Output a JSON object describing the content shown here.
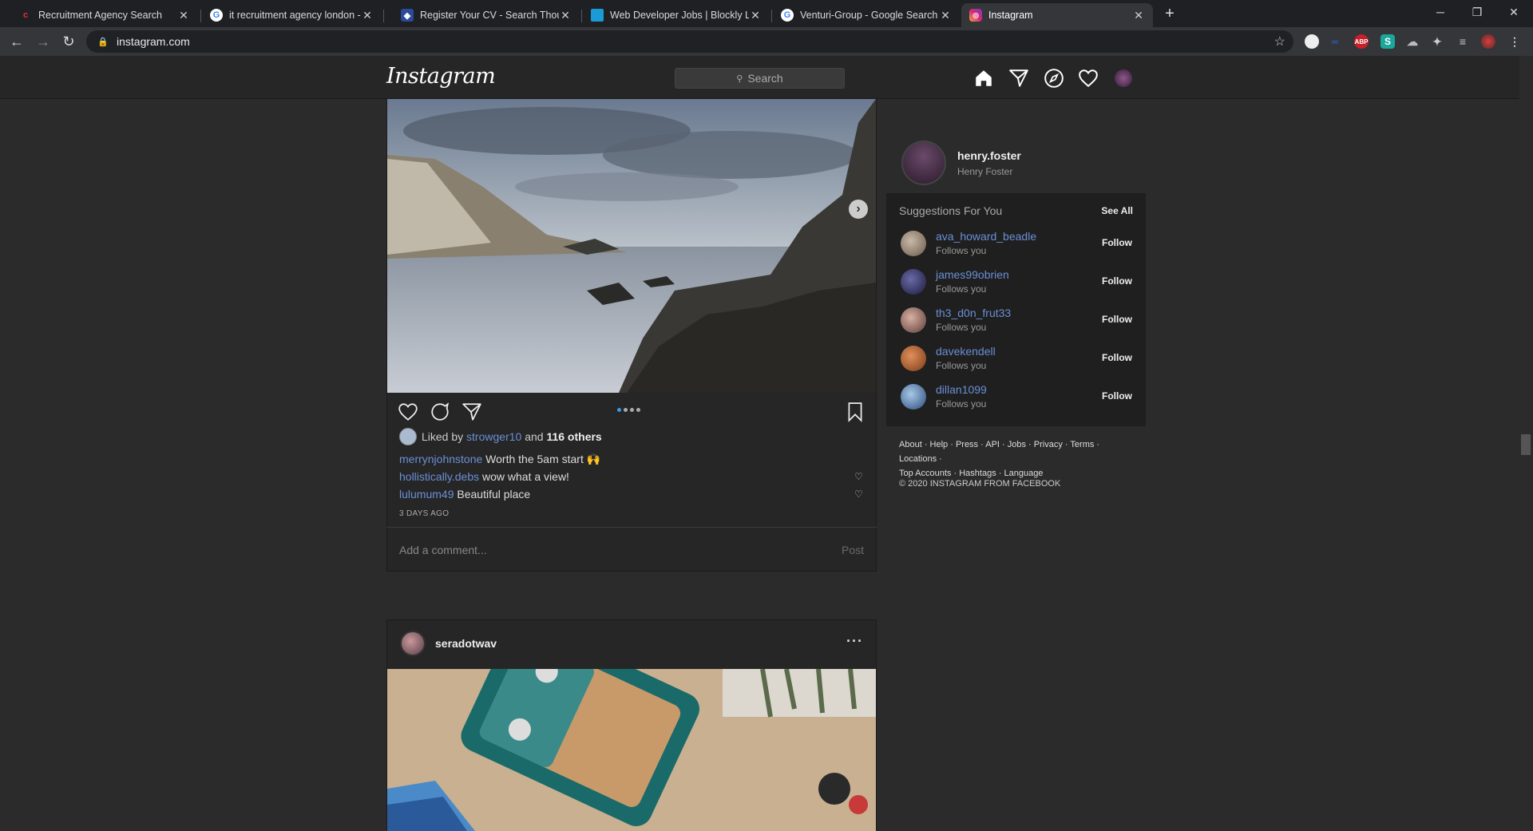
{
  "browser": {
    "tabs": [
      {
        "title": "Recruitment Agency Search",
        "favicon": "recruitment-favicon"
      },
      {
        "title": "it recruitment agency london - G",
        "favicon": "google-favicon"
      },
      {
        "title": "Register Your CV - Search Thousa",
        "favicon": "cv-favicon"
      },
      {
        "title": "Web Developer Jobs | Blockly Lo",
        "favicon": "blockly-favicon"
      },
      {
        "title": "Venturi-Group - Google Search",
        "favicon": "google-favicon"
      },
      {
        "title": "Instagram",
        "favicon": "instagram-favicon"
      }
    ],
    "url": "instagram.com",
    "extensions": [
      "ABP",
      "S"
    ]
  },
  "instagram": {
    "logo": "Instagram",
    "search_placeholder": "Search"
  },
  "post": {
    "liked_by_prefix": "Liked by",
    "liked_by_user": "strowger10",
    "liked_by_and": "and",
    "liked_by_others": "116 others",
    "comments": [
      {
        "user": "merrynjohnstone",
        "text": "Worth the 5am start 🙌"
      },
      {
        "user": "hollistically.debs",
        "text": "wow what a view!"
      },
      {
        "user": "lulumum49",
        "text": "Beautiful place"
      }
    ],
    "time_ago": "3 DAYS AGO",
    "add_comment_placeholder": "Add a comment...",
    "post_button": "Post"
  },
  "post2": {
    "username": "seradotwav",
    "more": "···"
  },
  "sidebar": {
    "username": "henry.foster",
    "full_name": "Henry Foster",
    "suggestions_title": "Suggestions For You",
    "see_all": "See All",
    "suggestions": [
      {
        "name": "ava_howard_beadle",
        "sub": "Follows you",
        "action": "Follow",
        "color": "#8a7a6a"
      },
      {
        "name": "james99obrien",
        "sub": "Follows you",
        "action": "Follow",
        "color": "#3a3a6a"
      },
      {
        "name": "th3_d0n_frut33",
        "sub": "Follows you",
        "action": "Follow",
        "color": "#7a5a5a"
      },
      {
        "name": "davekendell",
        "sub": "Follows you",
        "action": "Follow",
        "color": "#a0522d"
      },
      {
        "name": "dillan1099",
        "sub": "Follows you",
        "action": "Follow",
        "color": "#4a6a9a"
      }
    ],
    "footer_links": [
      "About",
      "Help",
      "Press",
      "API",
      "Jobs",
      "Privacy",
      "Terms",
      "Locations",
      "Top Accounts",
      "Hashtags",
      "Language"
    ],
    "copyright": "© 2020 INSTAGRAM FROM FACEBOOK"
  }
}
